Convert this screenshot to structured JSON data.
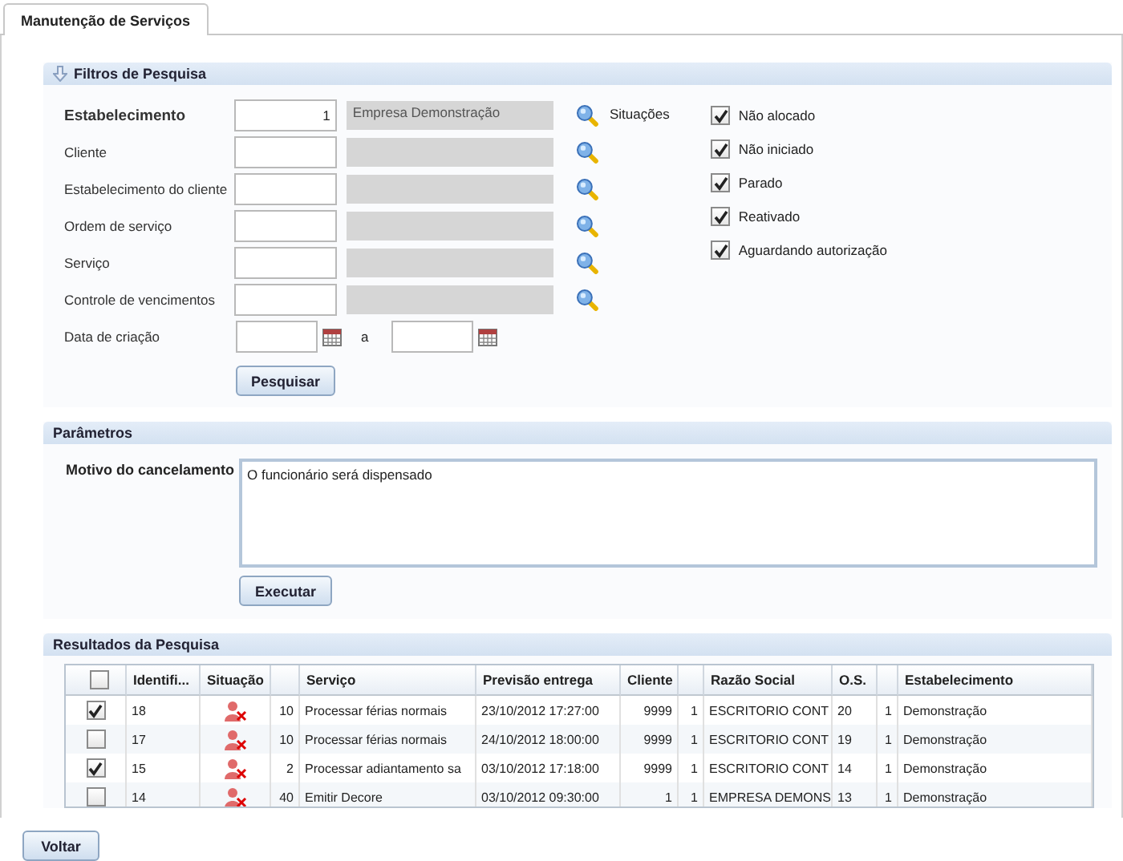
{
  "tab": {
    "label": "Manutenção de Serviços",
    "selected": true
  },
  "filters": {
    "title": "Filtros de Pesquisa",
    "fields": [
      {
        "label": "Estabelecimento",
        "emphasized": true,
        "value": "1",
        "description": "Empresa Demonstração"
      },
      {
        "label": "Cliente",
        "emphasized": false
      },
      {
        "label": "Estabelecimento do cliente",
        "emphasized": false
      },
      {
        "label": "Ordem de serviço",
        "emphasized": false
      },
      {
        "label": "Serviço",
        "emphasized": false
      },
      {
        "label": "Controle de vencimentos",
        "emphasized": false
      }
    ],
    "date": {
      "label": "Data de criação",
      "separator": "a"
    },
    "situations_label": "Situações",
    "situations": [
      {
        "label": "Não alocado",
        "checked": true
      },
      {
        "label": "Não iniciado",
        "checked": true
      },
      {
        "label": "Parado",
        "checked": true
      },
      {
        "label": "Reativado",
        "checked": true
      },
      {
        "label": "Aguardando autorização",
        "checked": true
      }
    ],
    "search_button": "Pesquisar"
  },
  "parameters": {
    "title": "Parâmetros",
    "label": "Motivo do cancelamento",
    "text": "O funcionário será dispensado",
    "button": "Executar"
  },
  "results": {
    "title": "Resultados da Pesquisa",
    "all_checked": false,
    "columns": [
      "Identifi...",
      "Situação",
      null,
      "Serviço",
      "Previsão entrega",
      "Cliente",
      null,
      "Razão Social",
      "O.S.",
      null,
      "Estabelecimento"
    ],
    "rows": [
      {
        "selected": true,
        "cells": [
          "18",
          {
            "kind": "icon"
          },
          "10",
          "Processar férias normais",
          "23/10/2012 17:27:00",
          "9999",
          "1",
          "ESCRITORIO CONT",
          "20",
          "1",
          "Demonstração"
        ]
      },
      {
        "selected": false,
        "cells": [
          "17",
          {
            "kind": "icon"
          },
          "10",
          "Processar férias normais",
          "24/10/2012 18:00:00",
          "9999",
          "1",
          "ESCRITORIO CONT",
          "19",
          "1",
          "Demonstração"
        ]
      },
      {
        "selected": true,
        "cells": [
          "15",
          {
            "kind": "icon"
          },
          "2",
          "Processar adiantamento sa",
          "03/10/2012 17:18:00",
          "9999",
          "1",
          "ESCRITORIO CONT",
          "14",
          "1",
          "Demonstração"
        ]
      },
      {
        "selected": false,
        "cells": [
          "14",
          {
            "kind": "icon"
          },
          "40",
          "Emitir Decore",
          "03/10/2012 09:30:00",
          "1",
          "1",
          "EMPRESA DEMONS",
          "13",
          "1",
          "Demonstração"
        ]
      }
    ]
  },
  "back_button": "Voltar"
}
